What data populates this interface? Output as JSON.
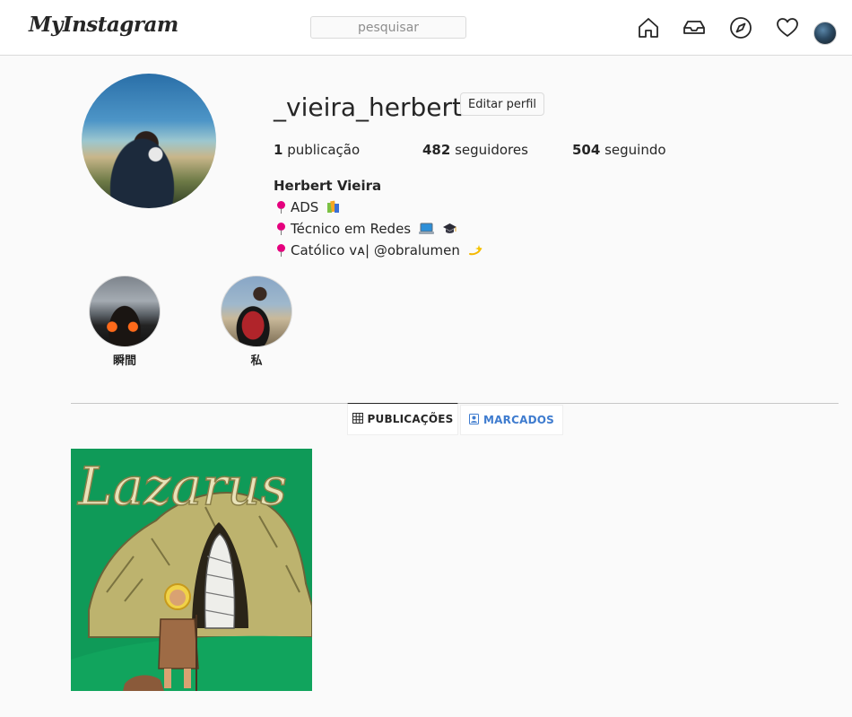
{
  "header": {
    "logo": "MyInstagram",
    "search_placeholder": "pesquisar",
    "icons": [
      "home-icon",
      "inbox-icon",
      "explore-icon",
      "heart-icon"
    ]
  },
  "profile": {
    "username": "_vieira_herbert",
    "edit_button": "Editar perfil",
    "stats": [
      {
        "count": "1",
        "label": "publicação"
      },
      {
        "count": "482",
        "label": "seguidores"
      },
      {
        "count": "504",
        "label": "seguindo"
      }
    ],
    "bio": {
      "name": "Herbert Vieira",
      "lines": [
        "ADS",
        "Técnico em Redes",
        "Católico vᴀ| @obralumen"
      ],
      "emojis": [
        "books",
        "laptop, graduation-cap",
        "sparkle"
      ]
    }
  },
  "highlights": [
    {
      "label": "瞬間"
    },
    {
      "label": "私"
    }
  ],
  "tabs": [
    {
      "label": "PUBLICAÇÕES",
      "icon": "grid-icon",
      "active": true
    },
    {
      "label": "MARCADOS",
      "icon": "tagged-icon",
      "active": false
    }
  ],
  "posts": [
    {
      "text": "Lazarus",
      "bg": "#0f9a58"
    }
  ],
  "colors": {
    "accent": "#3f7ccf",
    "pin": "#e5007e",
    "border": "#dbdbdb",
    "background": "#fafafa"
  }
}
